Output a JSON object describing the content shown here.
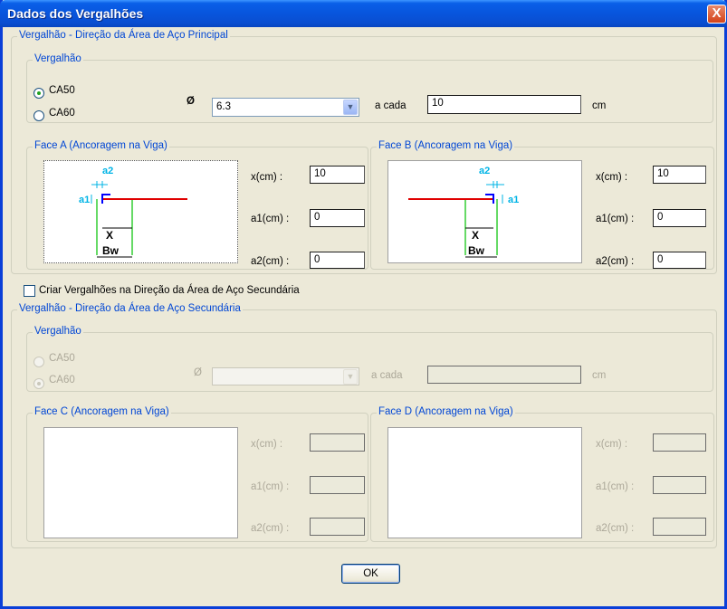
{
  "window": {
    "title": "Dados dos Vergalhões",
    "close_label": "X"
  },
  "principal": {
    "legend": "Vergalhão - Direção da Área de Aço Principal",
    "vergalhao": {
      "legend": "Vergalhão",
      "options": [
        "CA50",
        "CA60"
      ],
      "selected": "CA50",
      "diameter_symbol": "Ø",
      "diameter_value": "6.3",
      "a_cada_label": "a cada",
      "a_cada_value": "10",
      "unit": "cm"
    },
    "face_a": {
      "legend": "Face A (Ancoragem na Viga)",
      "fields": {
        "x_label": "x(cm) :",
        "x_value": "10",
        "a1_label": "a1(cm) :",
        "a1_value": "0",
        "a2_label": "a2(cm) :",
        "a2_value": "0"
      },
      "diagram": {
        "a1": "a1",
        "a2": "a2",
        "x": "X",
        "bw": "Bw"
      }
    },
    "face_b": {
      "legend": "Face B (Ancoragem na Viga)",
      "fields": {
        "x_label": "x(cm) :",
        "x_value": "10",
        "a1_label": "a1(cm) :",
        "a1_value": "0",
        "a2_label": "a2(cm) :",
        "a2_value": "0"
      },
      "diagram": {
        "a1": "a1",
        "a2": "a2",
        "x": "X",
        "bw": "Bw"
      }
    }
  },
  "secundaria_checkbox": {
    "label": "Criar Vergalhões na Direção da Área de Aço Secundária",
    "checked": false
  },
  "secundaria": {
    "legend": "Vergalhão - Direção da Área de Aço Secundária",
    "vergalhao": {
      "legend": "Vergalhão",
      "options": [
        "CA50",
        "CA60"
      ],
      "selected": "CA60",
      "diameter_symbol": "Ø",
      "a_cada_label": "a cada",
      "unit": "cm"
    },
    "face_c": {
      "legend": "Face C (Ancoragem na Viga)",
      "x_label": "x(cm) :",
      "a1_label": "a1(cm) :",
      "a2_label": "a2(cm) :"
    },
    "face_d": {
      "legend": "Face D (Ancoragem na Viga)",
      "x_label": "x(cm) :",
      "a1_label": "a1(cm) :",
      "a2_label": "a2(cm) :"
    }
  },
  "ok_button": "OK",
  "colors": {
    "title_bar": "#0a5fe8",
    "group_label": "#0046d5",
    "rebar_red": "#e00000",
    "dim_cyan": "#00b4e6",
    "hook_blue": "#0000ff",
    "beam_green": "#00c000",
    "disabled_text": "#aca899"
  }
}
